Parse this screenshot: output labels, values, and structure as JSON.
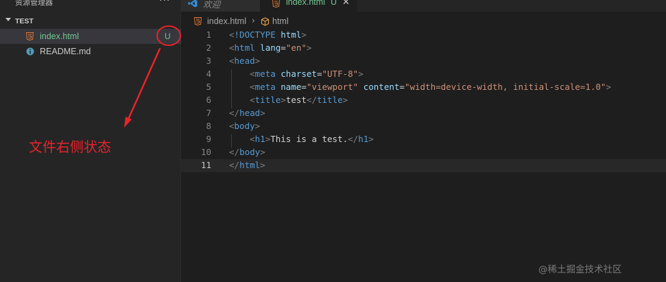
{
  "sidebar": {
    "title": "资源管理器",
    "more": "···",
    "folder": "TEST",
    "files": [
      {
        "name": "index.html",
        "status": "U"
      },
      {
        "name": "README.md"
      }
    ]
  },
  "tabs": [
    {
      "label": "欢迎"
    },
    {
      "label": "index.html",
      "status": "U",
      "close": "✕"
    }
  ],
  "breadcrumb": {
    "file": "index.html",
    "separator": "›",
    "symbol": "html"
  },
  "code_lines": [
    "<!DOCTYPE html>",
    "<html lang=\"en\">",
    "<head>",
    "    <meta charset=\"UTF-8\">",
    "    <meta name=\"viewport\" content=\"width=device-width, initial-scale=1.0\">",
    "    <title>test</title>",
    "</head>",
    "<body>",
    "    <h1>This is a test.</h1>",
    "</body>",
    "</html>"
  ],
  "active_line": 11,
  "annotation": {
    "text": "文件右侧状态",
    "color": "#e8242a"
  },
  "watermark": "@稀土掘金技术社区",
  "colors": {
    "untracked": "#73c991",
    "tag": "#569cd6",
    "attr": "#9cdcfe",
    "string": "#ce9178",
    "html_icon": "#e37933",
    "info_icon": "#519aba"
  }
}
